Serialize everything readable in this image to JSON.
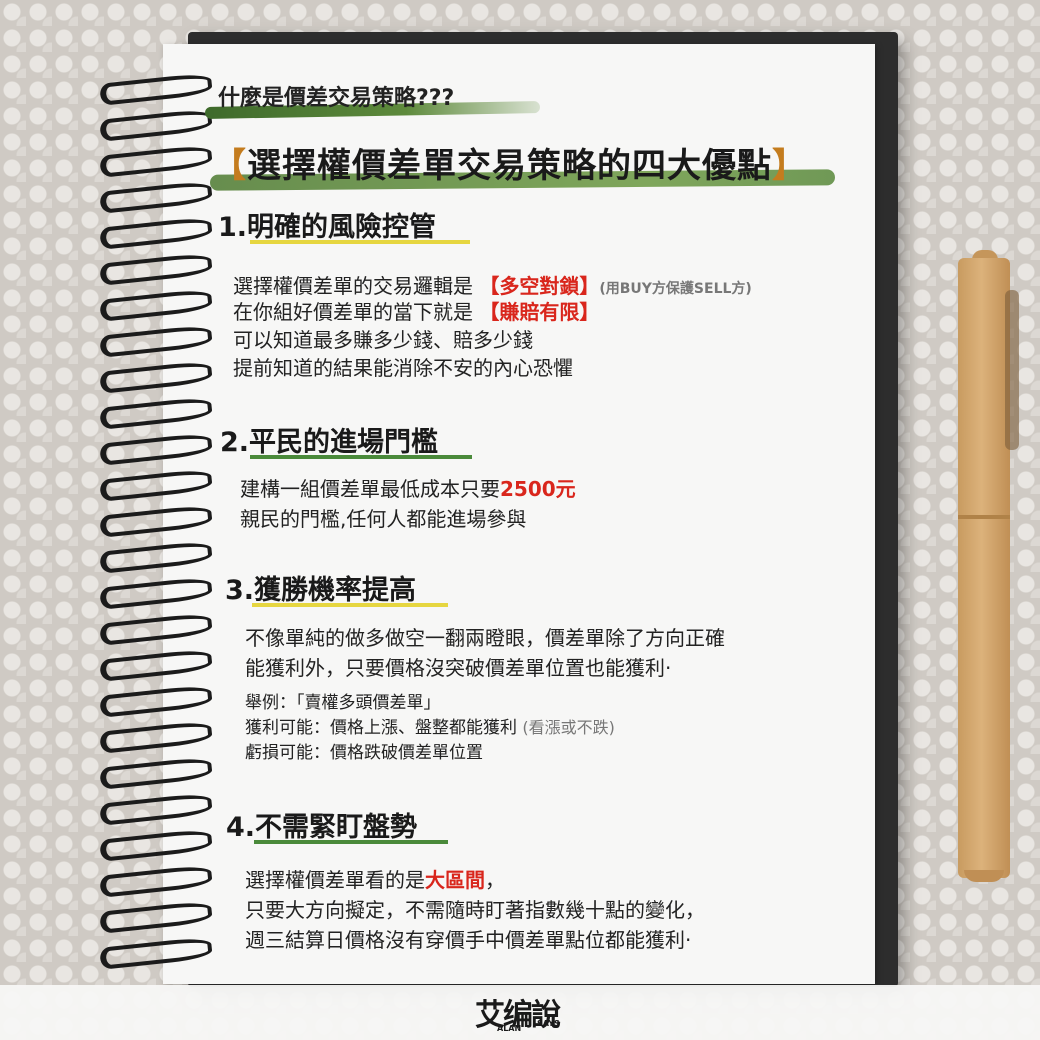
{
  "intro": "什麼是價差交易策略???",
  "title": {
    "open": "【",
    "text": "選擇權價差單交易策略的四大優點",
    "close": "】"
  },
  "sections": [
    {
      "heading": "1.明確的風險控管",
      "lines": [
        {
          "pre": "選擇權價差單的交易邏輯是 ",
          "red": "【多空對鎖】",
          "note": "(用BUY方保護SELL方)"
        },
        {
          "pre": "在你組好價差單的當下就是 ",
          "red": "【賺賠有限】"
        },
        {
          "pre": "可以知道最多賺多少錢、賠多少錢"
        },
        {
          "pre": "提前知道的結果能消除不安的內心恐懼"
        }
      ]
    },
    {
      "heading": "2.平民的進場門檻",
      "lines": [
        {
          "pre": "建構一組價差單最低成本只要",
          "red": "2500元"
        },
        {
          "pre": "親民的門檻,任何人都能進場參與"
        }
      ]
    },
    {
      "heading": "3.獲勝機率提高",
      "lines": [
        {
          "pre": "不像單純的做多做空一翻兩瞪眼，價差單除了方向正確"
        },
        {
          "pre": "能獲利外，只要價格沒突破價差單位置也能獲利·"
        }
      ],
      "example": [
        {
          "pre": "舉例：「賣權多頭價差單」"
        },
        {
          "pre": "獲利可能：價格上漲、盤整都能獲利 ",
          "note": "(看漲或不跌)"
        },
        {
          "pre": "虧損可能：價格跌破價差單位置"
        }
      ]
    },
    {
      "heading": "4.不需緊盯盤勢",
      "lines": [
        {
          "pre": "選擇權價差單看的是",
          "red": "大區間",
          "post": "，"
        },
        {
          "pre": "只要大方向擬定，不需隨時盯著指數幾十點的變化，"
        },
        {
          "pre": "週三結算日價格沒有穿價手中價差單點位都能獲利·"
        }
      ]
    }
  ],
  "logo": {
    "main": "艾编說",
    "sub1": "ALAN",
    "sub2": "SAYS"
  },
  "colors": {
    "accent_red": "#d9261c",
    "underline_yellow": "#e6d640",
    "underline_green": "#4a8a3a"
  }
}
